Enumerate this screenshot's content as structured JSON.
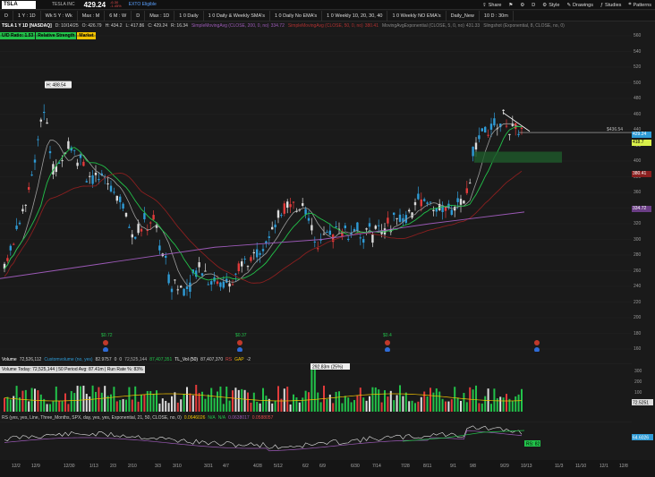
{
  "topbar": {
    "symbol": "TSLA",
    "company": "TESLA INC",
    "last": "429.24",
    "change_top": "-6.30",
    "change_bottom": "-1.45%",
    "exto": "EXTO Eligible",
    "share": "Share",
    "style": "Style",
    "drawings": "Drawings",
    "studies": "Studies",
    "patterns": "Patterns",
    "D": "D"
  },
  "toolbar": {
    "items": [
      "D",
      "1 Y : 1D",
      "Wk 5 Y : Wk",
      "Max : M",
      "6 M : W",
      "D",
      "Max : 1D",
      "1 0 Daily",
      "1 0 Daily & Weekly SMA's",
      "1 0 Daily No EMA's",
      "1 0 Weekly 10, 20, 30, 40",
      "1 0 Weekly NO EMA's",
      "Daily_New",
      "10 D : 30m"
    ],
    "30m": "30m"
  },
  "title": {
    "main": "TSLA 1 Y 1D [NASDAQ]",
    "date": "D: 10/14/25",
    "open": "O: 426.79",
    "high": "H: 434.2",
    "low": "L: 417.86",
    "close": "C: 429.24",
    "range": "R: 16.34",
    "sma200": "SimpleMovingAvg (CLOSE, 200, 0, no)",
    "sma200_val": "334.72",
    "sma50": "SimpleMovingAvg (CLOSE, 50, 0, no)",
    "sma50_val": "380.41",
    "ema": "MovingAvgExponential (CLOSE, 5, 0, no)",
    "ema_val": "431.33",
    "ema2": "Slingshot (Exponential, 8, CLOSE, no, 0)"
  },
  "studies": [
    "U/D Ratio: 1.53",
    "Relative Strength",
    "Market"
  ],
  "price_axis": [
    "560",
    "540",
    "520",
    "500",
    "480",
    "460",
    "440",
    "420",
    "400",
    "380",
    "360",
    "340",
    "320",
    "300",
    "280",
    "260",
    "240",
    "220",
    "200",
    "180",
    "160"
  ],
  "tags": {
    "p1": "436.54",
    "p2": "429.24",
    "p3": "418.7",
    "p4": "380.41",
    "p5": "334.72",
    "high_label": "H: 488.54"
  },
  "events": [
    "$0.72",
    "$0.37",
    "$0.4"
  ],
  "volume": {
    "label": "Volume",
    "value": "72,526,112",
    "cv": "Customvolume (no, yes)",
    "cv_val": "82.9757",
    "z1": "0",
    "z2": "0",
    "v2": "72,525,144",
    "v3": "87,407,351",
    "tl": "TL_Vol (50)",
    "tl_val": "87,407,370",
    "rs": "RS",
    "gap": "GAP",
    "gap_val": "-2",
    "today": "Volume Today: 72,525,144",
    "avg": "50 Period Avg: 87.41m",
    "run": "Run Rate %: 83%",
    "spike": "292.83m (25%)",
    "axis": [
      "300",
      "200",
      "100",
      "50"
    ],
    "cur": "72.5251"
  },
  "rs": {
    "label": "RS (yes, yes, Line, Three_Months, SPX, day, yes, yes, Exponential, 21, 50, CLOSE, no, 0)",
    "v1": "0.0646026",
    "na1": "N/A",
    "na2": "N/A",
    "v2": "0.0638017",
    "v3": "0.0588057",
    "tag": "RS: 82",
    "axis_val": "64.6026"
  },
  "dates": [
    "12/2",
    "12/9",
    "12/30",
    "1/13",
    "2/3",
    "2/10",
    "3/3",
    "3/10",
    "3/31",
    "4/7",
    "4/28",
    "5/12",
    "6/2",
    "6/9",
    "6/30",
    "7/14",
    "7/28",
    "8/11",
    "9/1",
    "9/8",
    "9/29",
    "10/13",
    "11/3",
    "11/10",
    "12/1",
    "12/8"
  ],
  "colors": {
    "up": "#2e9bd6",
    "down": "#e23b3b",
    "green": "#22c24a",
    "sma50": "#e03030",
    "sma200": "#9b59b6",
    "ema": "#9e9e9e"
  }
}
